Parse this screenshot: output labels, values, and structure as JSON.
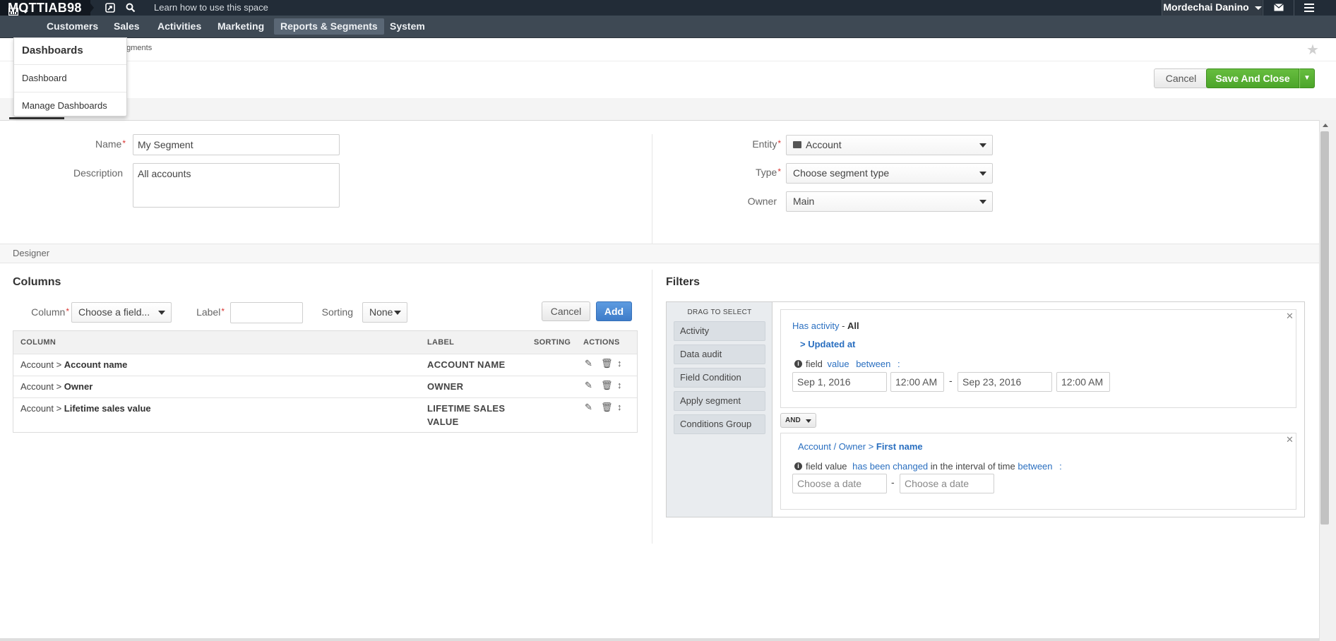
{
  "topbar": {
    "logo": "MOTTIAB98",
    "help_text": "Learn how to use this space",
    "user_name": "Mordechai Danino",
    "icons": [
      "bookmark-icon",
      "search-icon",
      "mail-icon",
      "hamburger-icon"
    ]
  },
  "nav": {
    "items": [
      "Customers",
      "Sales",
      "Activities",
      "Marketing",
      "Reports & Segments",
      "System"
    ],
    "active": "Reports & Segments"
  },
  "dashboards_menu": {
    "title": "Dashboards",
    "items": [
      "Dashboard",
      "Manage Dashboards"
    ]
  },
  "breadcrumb": "egments",
  "actions": {
    "cancel": "Cancel",
    "save_close": "Save And Close"
  },
  "form": {
    "name_label": "Name",
    "name_value": "My Segment",
    "description_label": "Description",
    "description_value": "All accounts",
    "entity_label": "Entity",
    "entity_value": "Account",
    "type_label": "Type",
    "type_value": "Choose segment type",
    "owner_label": "Owner",
    "owner_value": "Main"
  },
  "designer": {
    "label": "Designer"
  },
  "columns": {
    "title": "Columns",
    "column_label": "Column",
    "column_placeholder": "Choose a field...",
    "label_label": "Label",
    "sorting_label": "Sorting",
    "sorting_value": "None",
    "cancel": "Cancel",
    "add": "Add",
    "headers": [
      "COLUMN",
      "LABEL",
      "SORTING",
      "ACTIONS"
    ],
    "rows": [
      {
        "path": "Account > ",
        "field": "Account name",
        "label": "ACCOUNT NAME"
      },
      {
        "path": "Account > ",
        "field": "Owner",
        "label": "OWNER"
      },
      {
        "path": "Account > ",
        "field": "Lifetime sales value",
        "label": "LIFETIME SALES",
        "label2": "VALUE"
      }
    ]
  },
  "filters": {
    "title": "Filters",
    "drag_header": "DRAG TO SELECT",
    "drag_items": [
      "Activity",
      "Data audit",
      "Field Condition",
      "Apply segment",
      "Conditions Group"
    ],
    "cond1": {
      "has_activity": "Has activity",
      "dash": " - ",
      "all": "All",
      "updated_at": "> Updated at",
      "field_text": "field",
      "value_link": "value",
      "between_link": "between",
      "colon": ":",
      "date_from": "Sep 1, 2016",
      "time_from": "12:00 AM",
      "sep": "-",
      "date_to": "Sep 23, 2016",
      "time_to": "12:00 AM"
    },
    "operator": "AND",
    "cond2": {
      "path": "Account / Owner > ",
      "field": "First name",
      "field_text": "field value",
      "changed_link": "has been changed",
      "interval_text": "in the interval of time",
      "between_link": "between",
      "colon": ":",
      "date_from_placeholder": "Choose a date",
      "sep": "-",
      "date_to_placeholder": "Choose a date"
    }
  }
}
